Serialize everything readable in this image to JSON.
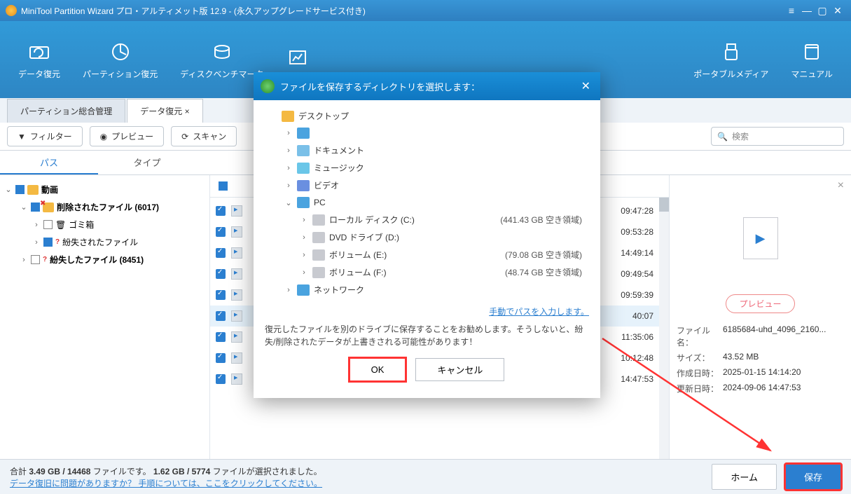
{
  "title": "MiniTool Partition Wizard プロ・アルティメット版 12.9 - (永久アップグレードサービス付き)",
  "toolbar": [
    {
      "label": "データ復元"
    },
    {
      "label": "パーティション復元"
    },
    {
      "label": "ディスクベンチマーク"
    },
    {
      "label": ""
    },
    {
      "label": "ポータブルメディア"
    },
    {
      "label": "マニュアル"
    }
  ],
  "tabs": {
    "manage": "パーティション総合管理",
    "recovery": "データ復元 ×"
  },
  "btns": {
    "filter": "フィルター",
    "preview": "プレビュー",
    "scan": "スキャン"
  },
  "search_ph": "検索",
  "subtabs": {
    "path": "パス",
    "type": "タイプ"
  },
  "tree": [
    {
      "type": "root",
      "label": "動画",
      "indent": 0,
      "chev": "⌄",
      "chk": "blue"
    },
    {
      "type": "folder",
      "label": "削除されたファイル (6017)",
      "indent": 1,
      "chev": "⌄",
      "chk": "blue",
      "bold": true
    },
    {
      "type": "trash",
      "label": "ゴミ箱",
      "indent": 2,
      "chev": "›",
      "chk": "empty"
    },
    {
      "type": "lost",
      "label": "紛失されたファイル",
      "indent": 2,
      "chev": "›",
      "chk": "blue"
    },
    {
      "type": "lost2",
      "label": "紛失したファイル (8451)",
      "indent": 1,
      "chev": "›",
      "chk": "empty"
    }
  ],
  "list": [
    {
      "time": "09:47:28"
    },
    {
      "time": "09:53:28"
    },
    {
      "time": "14:49:14"
    },
    {
      "time": "09:49:54"
    },
    {
      "time": "09:59:39"
    },
    {
      "time": "40:07",
      "hl": true
    },
    {
      "time": "11:35:06"
    },
    {
      "time": "10:12:48"
    },
    {
      "time": "14:47:53"
    }
  ],
  "right": {
    "preview_btn": "プレビュー",
    "filename_lbl": "ファイル名：",
    "filename_val": "6185684-uhd_4096_2160...",
    "size_lbl": "サイズ：",
    "size_val": "43.52 MB",
    "created_lbl": "作成日時：",
    "created_val": "2025-01-15 14:14:20",
    "updated_lbl": "更新日時：",
    "updated_val": "2024-09-06 14:47:53"
  },
  "footer": {
    "summary_a": "合計",
    "summary_b": "3.49 GB / 14468",
    "summary_c": "ファイルです。",
    "summary_d": "1.62 GB / 5774",
    "summary_e": "ファイルが選択されました。",
    "link": "データ復旧に問題がありますか？ 手順については、ここをクリックしてください。",
    "home": "ホーム",
    "save": "保存"
  },
  "modal": {
    "title": "ファイルを保存するディレクトリを選択します：",
    "rows": [
      {
        "label": "デスクトップ",
        "indent": 0,
        "chev": "",
        "ico": "fold"
      },
      {
        "label": "",
        "indent": 1,
        "chev": "›",
        "ico": "user"
      },
      {
        "label": "ドキュメント",
        "indent": 1,
        "chev": "›",
        "ico": "doc"
      },
      {
        "label": "ミュージック",
        "indent": 1,
        "chev": "›",
        "ico": "music"
      },
      {
        "label": "ビデオ",
        "indent": 1,
        "chev": "›",
        "ico": "vid"
      },
      {
        "label": "PC",
        "indent": 1,
        "chev": "⌄",
        "ico": "pc"
      },
      {
        "label": "ローカル ディスク (C:)",
        "indent": 2,
        "chev": "›",
        "ico": "drive",
        "free": "(441.43 GB 空き領域)"
      },
      {
        "label": "DVD ドライブ (D:)",
        "indent": 2,
        "chev": "›",
        "ico": "drive",
        "free": ""
      },
      {
        "label": "ボリューム (E:)",
        "indent": 2,
        "chev": "›",
        "ico": "drive",
        "free": "(79.08 GB 空き領域)"
      },
      {
        "label": "ボリューム (F:)",
        "indent": 2,
        "chev": "›",
        "ico": "drive",
        "free": "(48.74 GB 空き領域)"
      },
      {
        "label": "ネットワーク",
        "indent": 1,
        "chev": "›",
        "ico": "net"
      }
    ],
    "link": "手動でパスを入力します。",
    "warn": "復元したファイルを別のドライブに保存することをお勧めします。そうしないと、紛失/削除されたデータが上書きされる可能性があります！",
    "ok": "OK",
    "cancel": "キャンセル"
  }
}
